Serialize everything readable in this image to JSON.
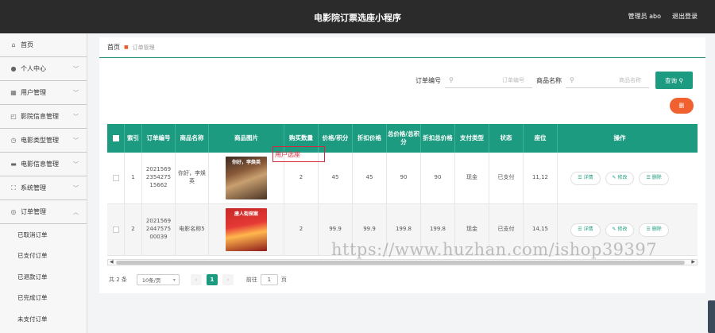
{
  "header": {
    "title": "电影院订票选座小程序",
    "user": "管理员 abo",
    "logout": "退出登录"
  },
  "sidebar": {
    "items": [
      {
        "label": "首页",
        "icon": "home-icon"
      },
      {
        "label": "个人中心",
        "icon": "user-icon"
      },
      {
        "label": "用户管理",
        "icon": "users-icon"
      },
      {
        "label": "影院信息管理",
        "icon": "cinema-icon"
      },
      {
        "label": "电影类型管理",
        "icon": "clock-icon"
      },
      {
        "label": "电影信息管理",
        "icon": "monitor-icon"
      },
      {
        "label": "系统管理",
        "icon": "settings-icon"
      },
      {
        "label": "订单管理",
        "icon": "order-icon"
      }
    ],
    "subitems": [
      "已取消订单",
      "已支付订单",
      "已退款订单",
      "已完成订单",
      "未支付订单"
    ]
  },
  "breadcrumb": {
    "home": "首页",
    "current": "订单管理"
  },
  "search": {
    "order_no_label": "订单编号",
    "order_no_placeholder": "订单编号",
    "product_label": "商品名称",
    "product_placeholder": "商品名称",
    "query_label": "查询"
  },
  "delete_label": "删",
  "table": {
    "headers": [
      "索引",
      "订单编号",
      "商品名称",
      "商品图片",
      "购买数量",
      "价格/积分",
      "折扣价格",
      "总价格/总积分",
      "折扣总价格",
      "支付类型",
      "状态",
      "座位",
      "操作"
    ],
    "rows": [
      {
        "index": "1",
        "order_no": "2021569235427515662",
        "product": "你好，李焕英",
        "poster_title": "你好，李焕英",
        "qty": "2",
        "price": "45",
        "discount": "45",
        "total": "90",
        "discount_total": "90",
        "pay": "现金",
        "status": "已支付",
        "seat": "11,12"
      },
      {
        "index": "2",
        "order_no": "2021569244757500039",
        "product": "电影名称5",
        "poster_title": "唐人街探案",
        "qty": "2",
        "price": "99.9",
        "discount": "99.9",
        "total": "199.8",
        "discount_total": "199.8",
        "pay": "现金",
        "status": "已支付",
        "seat": "14,15"
      }
    ],
    "actions": [
      "详情",
      "修改",
      "删除"
    ]
  },
  "pager": {
    "total": "共 2 条",
    "page_size": "10条/页",
    "current": "1",
    "goto_label": "前往",
    "goto_value": "1",
    "page_unit": "页"
  },
  "annotation": "用户选座",
  "watermark": "https://www.huzhan.com/ishop39397"
}
